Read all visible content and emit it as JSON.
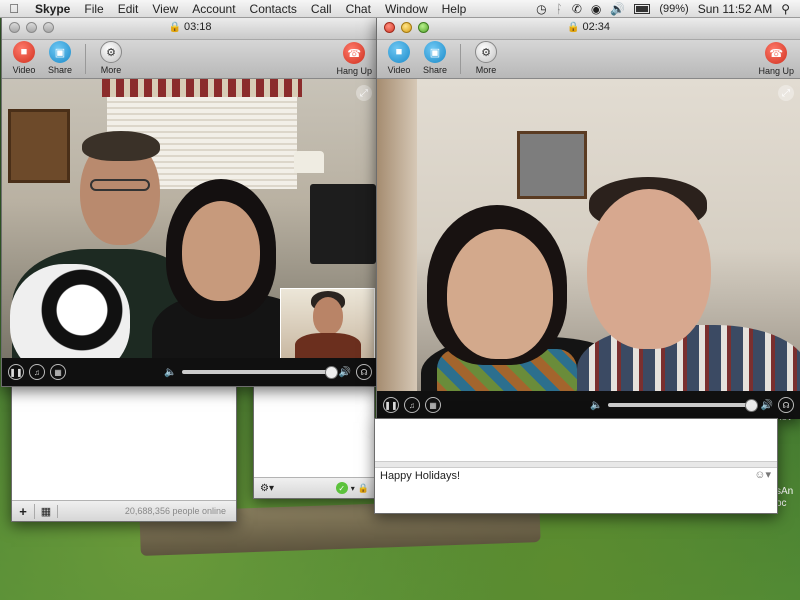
{
  "menubar": {
    "app_name": "Skype",
    "items": [
      "File",
      "Edit",
      "View",
      "Account",
      "Contacts",
      "Call",
      "Chat",
      "Window",
      "Help"
    ],
    "battery": "(99%)",
    "clock": "Sun 11:52 AM"
  },
  "call_left": {
    "timer": "03:18",
    "toolbar": {
      "video": "Video",
      "share": "Share",
      "more": "More",
      "hang_up": "Hang Up"
    },
    "volume": 0.98
  },
  "call_right": {
    "timer": "02:34",
    "toolbar": {
      "video": "Video",
      "share": "Share",
      "more": "More",
      "hang_up": "Hang Up"
    },
    "volume": 0.97,
    "chat_input": "Happy Holidays!"
  },
  "contacts_window": {
    "status": "20,688,356 people online"
  },
  "desktop_edge_text": [
    "nov",
    "sAn",
    "oc"
  ]
}
